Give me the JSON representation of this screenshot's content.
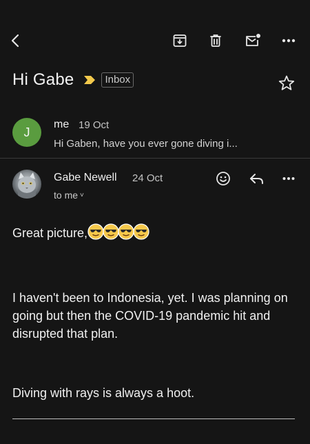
{
  "subject": "Hi Gabe",
  "label": "Inbox",
  "colors": {
    "background": "#151515",
    "avatar_j": "#5a9c3f",
    "importance": "#f2c94c"
  },
  "toolbar_icons": [
    "back-arrow-icon",
    "archive-icon",
    "trash-icon",
    "mark-unread-icon",
    "more-icon"
  ],
  "message1": {
    "avatar_initial": "J",
    "sender": "me",
    "date": "19 Oct",
    "snippet": "Hi Gaben, have you ever gone diving i..."
  },
  "message2": {
    "sender": "Gabe Newell",
    "date": "24 Oct",
    "recipient": "to me",
    "body": {
      "line1": "Great picture,",
      "para2": "I haven't been to Indonesia, yet.  I was planning on going but then the COVID-19 pandemic hit and disrupted that plan.",
      "para3": "Diving with rays is always a hoot."
    }
  }
}
